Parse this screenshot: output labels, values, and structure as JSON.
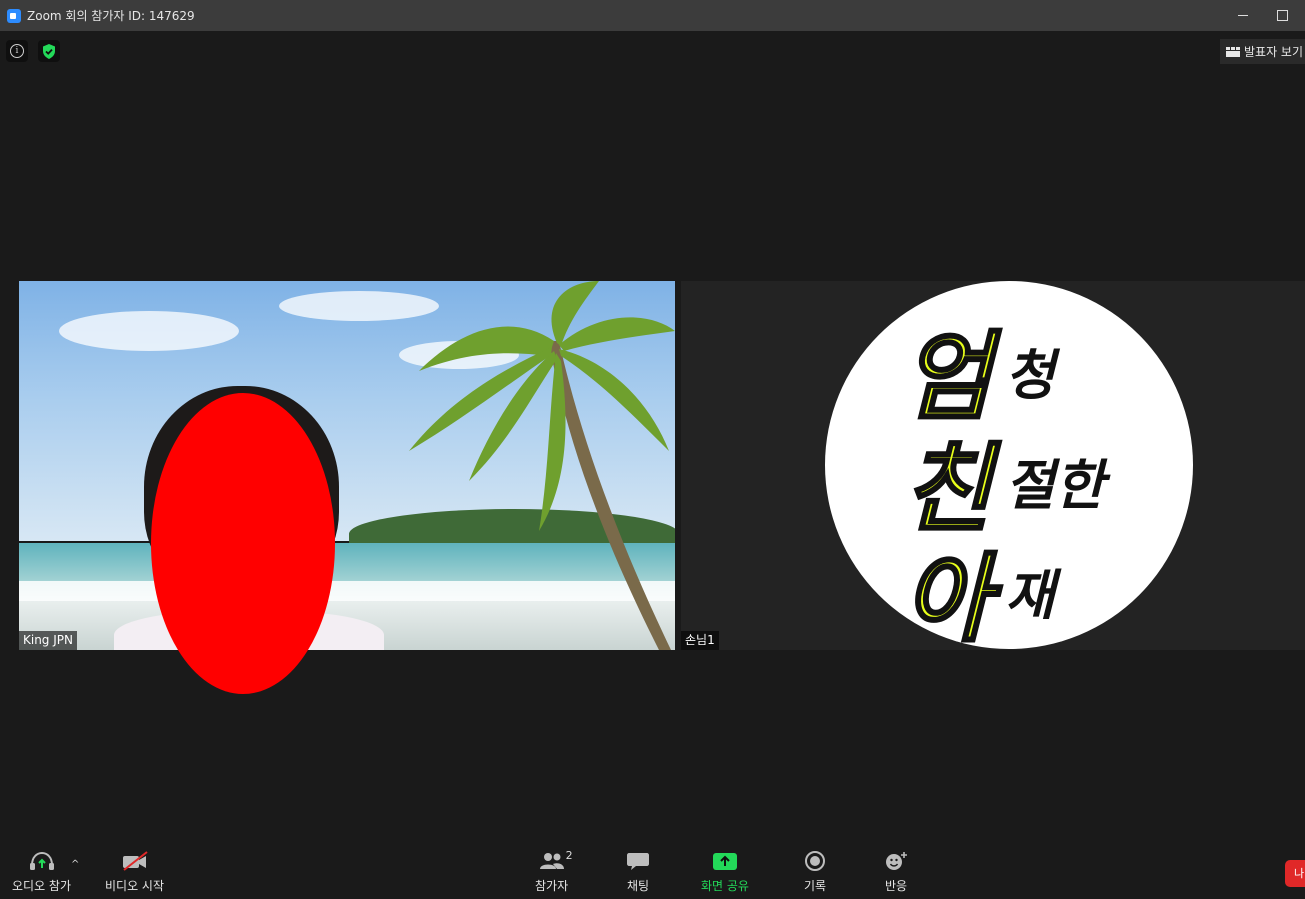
{
  "window": {
    "title": "Zoom 회의 참가자 ID: 147629"
  },
  "top_right": {
    "speaker_view_label": "발표자 보기"
  },
  "tiles": [
    {
      "name": "King JPN"
    },
    {
      "name": "손님1"
    }
  ],
  "avatar_text": {
    "big": [
      "엄",
      "친",
      "아"
    ],
    "small": [
      "청",
      "절한",
      "재"
    ]
  },
  "toolbar": {
    "audio_label": "오디오 참가",
    "video_label": "비디오 시작",
    "participants_label": "참가자",
    "participants_count": "2",
    "chat_label": "채팅",
    "share_label": "화면 공유",
    "record_label": "기록",
    "reactions_label": "반응",
    "leave_label": "나"
  },
  "colors": {
    "share_accent": "#23d959",
    "security_green": "#23d959",
    "leave_red": "#e02828",
    "avatar_yellow": "#e8ff1a"
  }
}
